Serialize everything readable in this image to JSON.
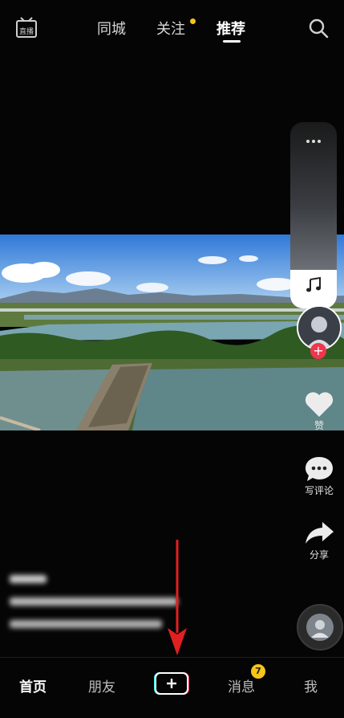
{
  "header": {
    "live_icon_text": "直播",
    "tabs": [
      "同城",
      "关注",
      "推荐"
    ],
    "active_tab": "推荐",
    "follow_dot_color": "#f5c518",
    "search_icon": "search-icon"
  },
  "side_actions": {
    "like_label": "赞",
    "comment_label": "写评论",
    "share_label": "分享",
    "follow_button_color": "#f0354f"
  },
  "bottom_nav": {
    "items": [
      "首页",
      "朋友",
      "消息",
      "我"
    ],
    "active_item": "首页",
    "message_badge": "7",
    "badge_color": "#f5c518"
  },
  "annotation": {
    "arrow_color": "#e02020"
  }
}
